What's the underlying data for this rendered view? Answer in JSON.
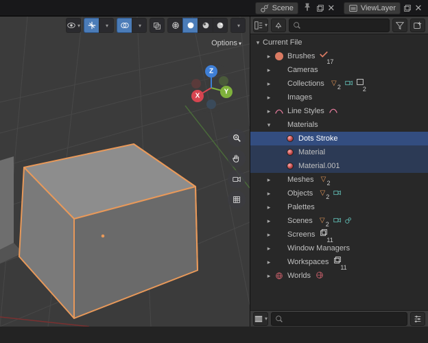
{
  "header": {
    "scene_label": "Scene",
    "viewlayer_label": "ViewLayer"
  },
  "viewport": {
    "options_label": "Options"
  },
  "gizmo": {
    "x": "X",
    "y": "Y",
    "z": "Z"
  },
  "outliner": {
    "search_placeholder": "",
    "root": "Current File",
    "categories": [
      {
        "label": "Brushes",
        "icon": "brush",
        "badges": [
          {
            "t": "fake",
            "n": "17"
          }
        ]
      },
      {
        "label": "Cameras",
        "icon": "cam"
      },
      {
        "label": "Collections",
        "icon": "collection",
        "badges": [
          {
            "t": "tri",
            "n": "2"
          },
          {
            "t": "cam"
          },
          {
            "t": "col",
            "n": "2"
          }
        ]
      },
      {
        "label": "Images",
        "icon": "image"
      },
      {
        "label": "Line Styles",
        "icon": "linestyle",
        "badges": [
          {
            "t": "ls"
          }
        ]
      },
      {
        "label": "Materials",
        "icon": "material",
        "expanded": true,
        "children": [
          {
            "label": "Dots Stroke",
            "icon": "mat"
          },
          {
            "label": "Material",
            "icon": "mat"
          },
          {
            "label": "Material.001",
            "icon": "mat"
          }
        ]
      },
      {
        "label": "Meshes",
        "icon": "mesh",
        "badges": [
          {
            "t": "tri",
            "n": "2"
          }
        ]
      },
      {
        "label": "Objects",
        "icon": "object",
        "badges": [
          {
            "t": "tri",
            "n": "2"
          },
          {
            "t": "cam"
          }
        ]
      },
      {
        "label": "Palettes",
        "icon": "palette"
      },
      {
        "label": "Scenes",
        "icon": "scene",
        "badges": [
          {
            "t": "tri",
            "n": "2"
          },
          {
            "t": "cam"
          },
          {
            "t": "scene"
          }
        ]
      },
      {
        "label": "Screens",
        "icon": "screen",
        "badges": [
          {
            "t": "screen",
            "n": "11"
          }
        ]
      },
      {
        "label": "Window Managers",
        "icon": "wm"
      },
      {
        "label": "Workspaces",
        "icon": "workspace",
        "badges": [
          {
            "t": "screen",
            "n": "11"
          }
        ]
      },
      {
        "label": "Worlds",
        "icon": "world",
        "badges": [
          {
            "t": "world"
          }
        ]
      }
    ]
  }
}
